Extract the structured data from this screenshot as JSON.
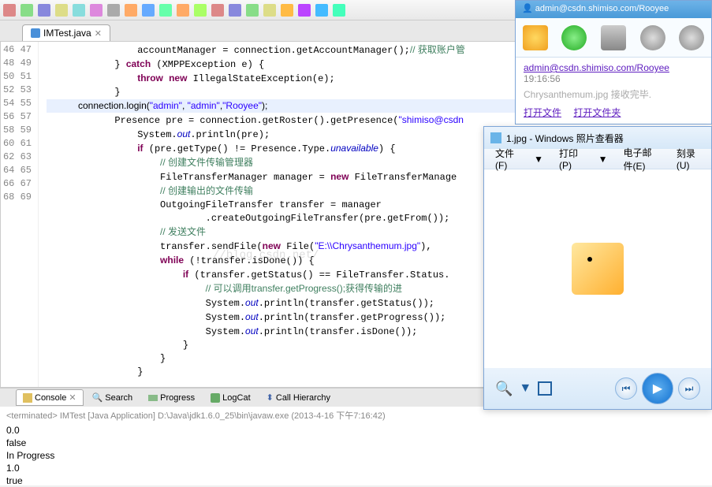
{
  "toolbar_icons": [
    "new",
    "save",
    "play",
    "debug",
    "stop",
    "refresh",
    "search",
    "package",
    "ant",
    "bug",
    "sync",
    "open",
    "settings",
    "help",
    "more1",
    "more2",
    "more3",
    "more4",
    "more5",
    "more6",
    "more7",
    "more8"
  ],
  "editor": {
    "tab_label": "IMTest.java",
    "line_start": 46,
    "lines": [
      {
        "indent": 16,
        "parts": [
          {
            "t": "accountManager = connection.getAccountManager();"
          },
          {
            "t": "// 获取账户管",
            "c": "cmt"
          }
        ]
      },
      {
        "indent": 12,
        "parts": [
          {
            "t": "} "
          },
          {
            "t": "catch",
            "c": "kw"
          },
          {
            "t": " (XMPPException e) {"
          }
        ]
      },
      {
        "indent": 16,
        "parts": [
          {
            "t": "throw",
            "c": "kw"
          },
          {
            "t": " "
          },
          {
            "t": "new",
            "c": "kw"
          },
          {
            "t": " IllegalStateException(e);"
          }
        ]
      },
      {
        "indent": 12,
        "parts": [
          {
            "t": "}"
          }
        ]
      },
      {
        "indent": 12,
        "hl": true,
        "parts": [
          {
            "t": "connection.login("
          },
          {
            "t": "\"admin\"",
            "c": "str"
          },
          {
            "t": ", "
          },
          {
            "t": "\"admin\"",
            "c": "str"
          },
          {
            "t": ","
          },
          {
            "t": "\"Rooyee\"",
            "c": "str"
          },
          {
            "t": ");"
          }
        ]
      },
      {
        "indent": 12,
        "parts": [
          {
            "t": "Presence pre = connection.getRoster().getPresence("
          },
          {
            "t": "\"shimiso@csdn",
            "c": "str"
          }
        ]
      },
      {
        "indent": 16,
        "parts": [
          {
            "t": "System."
          },
          {
            "t": "out",
            "c": "stat"
          },
          {
            "t": ".println(pre);"
          }
        ]
      },
      {
        "indent": 16,
        "parts": [
          {
            "t": "if",
            "c": "kw"
          },
          {
            "t": " (pre.getType() != Presence.Type."
          },
          {
            "t": "unavailable",
            "c": "stat"
          },
          {
            "t": ") {"
          }
        ]
      },
      {
        "indent": 20,
        "parts": [
          {
            "t": "// 创建文件传输管理器",
            "c": "cmt"
          }
        ]
      },
      {
        "indent": 20,
        "parts": [
          {
            "t": "FileTransferManager manager = "
          },
          {
            "t": "new",
            "c": "kw"
          },
          {
            "t": " FileTransferManage"
          }
        ]
      },
      {
        "indent": 20,
        "parts": [
          {
            "t": "// 创建输出的文件传输",
            "c": "cmt"
          }
        ]
      },
      {
        "indent": 20,
        "parts": [
          {
            "t": "OutgoingFileTransfer transfer = manager"
          }
        ]
      },
      {
        "indent": 28,
        "parts": [
          {
            "t": ".createOutgoingFileTransfer(pre.getFrom());"
          }
        ]
      },
      {
        "indent": 20,
        "parts": [
          {
            "t": "// 发送文件",
            "c": "cmt"
          }
        ]
      },
      {
        "indent": 20,
        "parts": [
          {
            "t": "transfer.sendFile("
          },
          {
            "t": "new",
            "c": "kw"
          },
          {
            "t": " File("
          },
          {
            "t": "\"E:\\\\Chrysanthemum.jpg\"",
            "c": "str"
          },
          {
            "t": "),"
          }
        ]
      },
      {
        "indent": 20,
        "parts": [
          {
            "t": "while",
            "c": "kw"
          },
          {
            "t": " (!transfer.isDone()) {"
          }
        ]
      },
      {
        "indent": 24,
        "parts": [
          {
            "t": "if",
            "c": "kw"
          },
          {
            "t": " (transfer.getStatus() == FileTransfer.Status."
          }
        ]
      },
      {
        "indent": 28,
        "parts": [
          {
            "t": "// 可以调用",
            "c": "cmt"
          },
          {
            "t": "transfer.getProgress();",
            "c": "cmt"
          },
          {
            "t": "获得传输的进",
            "c": "cmt"
          }
        ]
      },
      {
        "indent": 28,
        "parts": [
          {
            "t": "System."
          },
          {
            "t": "out",
            "c": "stat"
          },
          {
            "t": ".println(transfer.getStatus());"
          }
        ]
      },
      {
        "indent": 28,
        "parts": [
          {
            "t": "System."
          },
          {
            "t": "out",
            "c": "stat"
          },
          {
            "t": ".println(transfer.getProgress());"
          }
        ]
      },
      {
        "indent": 28,
        "parts": [
          {
            "t": "System."
          },
          {
            "t": "out",
            "c": "stat"
          },
          {
            "t": ".println(transfer.isDone());"
          }
        ]
      },
      {
        "indent": 24,
        "parts": [
          {
            "t": "}"
          }
        ]
      },
      {
        "indent": 20,
        "parts": [
          {
            "t": "}"
          }
        ]
      },
      {
        "indent": 16,
        "parts": [
          {
            "t": "}"
          }
        ]
      }
    ]
  },
  "watermark": "//blog.csdn.net/",
  "bottom_tabs": {
    "console": "Console",
    "search": "Search",
    "progress": "Progress",
    "logcat": "LogCat",
    "callhier": "Call Hierarchy"
  },
  "console": {
    "header": "<terminated> IMTest [Java Application] D:\\Java\\jdk1.6.0_25\\bin\\javaw.exe (2013-4-16 下午7:16:42)",
    "lines": [
      "0.0",
      "false",
      "In Progress",
      "1.0",
      "true"
    ]
  },
  "im": {
    "title": "admin@csdn.shimiso.com/Rooyee",
    "link": "admin@csdn.shimiso.com/Rooyee",
    "time": "19:16:56",
    "file": "Chrysanthemum.jpg",
    "status": "接收完毕.",
    "open_file": "打开文件",
    "open_folder": "打开文件夹"
  },
  "viewer": {
    "title": "1.jpg - Windows 照片查看器",
    "menu": {
      "file": "文件(F)",
      "print": "打印(P)",
      "email": "电子邮件(E)",
      "burn": "刻录(U)"
    }
  }
}
